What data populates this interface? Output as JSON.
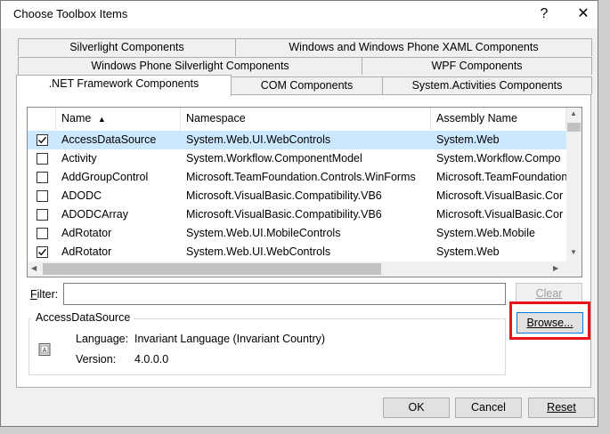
{
  "window": {
    "title": "Choose Toolbox Items",
    "help_glyph": "?",
    "close_glyph": "✕"
  },
  "tabs": [
    {
      "label": "Silverlight Components",
      "active": false
    },
    {
      "label": "Windows and Windows Phone XAML Components",
      "active": false
    },
    {
      "label": "Windows Phone Silverlight Components",
      "active": false
    },
    {
      "label": "WPF Components",
      "active": false
    },
    {
      "label": ".NET Framework Components",
      "active": true
    },
    {
      "label": "COM Components",
      "active": false
    },
    {
      "label": "System.Activities Components",
      "active": false
    }
  ],
  "list": {
    "columns": [
      "Name",
      "Namespace",
      "Assembly Name"
    ],
    "sort_indicator": "▲",
    "rows": [
      {
        "checked": true,
        "name": "AccessDataSource",
        "namespace": "System.Web.UI.WebControls",
        "assembly": "System.Web",
        "selected": true
      },
      {
        "checked": false,
        "name": "Activity",
        "namespace": "System.Workflow.ComponentModel",
        "assembly": "System.Workflow.Compo",
        "selected": false
      },
      {
        "checked": false,
        "name": "AddGroupControl",
        "namespace": "Microsoft.TeamFoundation.Controls.WinForms",
        "assembly": "Microsoft.TeamFoundation",
        "selected": false
      },
      {
        "checked": false,
        "name": "ADODC",
        "namespace": "Microsoft.VisualBasic.Compatibility.VB6",
        "assembly": "Microsoft.VisualBasic.Cor",
        "selected": false
      },
      {
        "checked": false,
        "name": "ADODCArray",
        "namespace": "Microsoft.VisualBasic.Compatibility.VB6",
        "assembly": "Microsoft.VisualBasic.Cor",
        "selected": false
      },
      {
        "checked": false,
        "name": "AdRotator",
        "namespace": "System.Web.UI.MobileControls",
        "assembly": "System.Web.Mobile",
        "selected": false
      },
      {
        "checked": true,
        "name": "AdRotator",
        "namespace": "System.Web.UI.WebControls",
        "assembly": "System.Web",
        "selected": false
      }
    ]
  },
  "filter": {
    "label_prefix": "F",
    "label_rest": "ilter:",
    "value": "",
    "clear_label": "Clear"
  },
  "details": {
    "group_title": "AccessDataSource",
    "language_label": "Language:",
    "language_value": "Invariant Language (Invariant Country)",
    "version_label": "Version:",
    "version_value": "4.0.0.0"
  },
  "buttons": {
    "browse": "Browse...",
    "ok": "OK",
    "cancel": "Cancel",
    "reset": "Reset"
  },
  "colors": {
    "highlight_box": "#e8141a",
    "selected_row": "#cce8ff"
  }
}
